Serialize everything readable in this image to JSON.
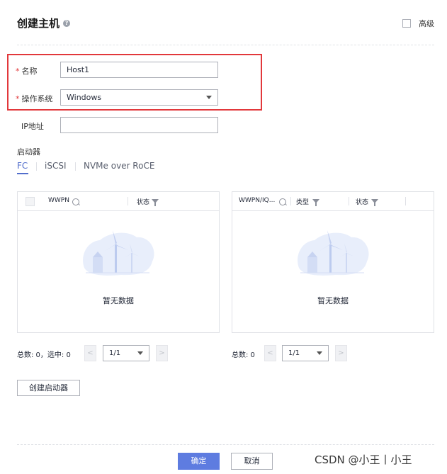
{
  "dialog": {
    "title": "创建主机",
    "help_icon": "?",
    "advanced_label": "高级"
  },
  "form": {
    "required_mark": "*",
    "name_label": "名称",
    "name_value": "Host1",
    "os_label": "操作系统",
    "os_value": "Windows",
    "ip_label": "IP地址",
    "ip_value": ""
  },
  "initiator": {
    "section_label": "启动器",
    "tabs": [
      {
        "label": "FC"
      },
      {
        "label": "iSCSI"
      },
      {
        "label": "NVMe over RoCE"
      }
    ],
    "active_tab": "FC"
  },
  "left_table": {
    "columns": [
      "WWPN",
      "状态"
    ],
    "empty_text": "暂无数据",
    "pagination": {
      "summary": "总数: 0，选中: 0",
      "prev": "<",
      "page": "1/1",
      "next": ">"
    }
  },
  "right_table": {
    "columns": [
      "WWPN/IQ...",
      "类型",
      "状态"
    ],
    "empty_text": "暂无数据",
    "pagination": {
      "summary": "总数: 0",
      "prev": "<",
      "page": "1/1",
      "next": ">"
    }
  },
  "actions": {
    "create_initiator": "创建启动器",
    "confirm": "确定",
    "cancel": "取消"
  },
  "watermark": "CSDN @小王丨小王",
  "colors": {
    "accent": "#5e7ce0",
    "tab_active": "#526ecc",
    "highlight_border": "#e2383b",
    "required": "#e2383b"
  }
}
